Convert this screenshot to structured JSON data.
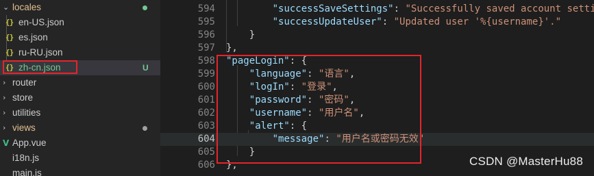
{
  "explorer": {
    "items": [
      {
        "label": "locales",
        "type": "folder-open",
        "color": "#e2c08d",
        "decoration": "dot",
        "decoration_color": "#73c991"
      },
      {
        "label": "en-US.json",
        "type": "json"
      },
      {
        "label": "es.json",
        "type": "json"
      },
      {
        "label": "ru-RU.json",
        "type": "json"
      },
      {
        "label": "zh-cn.json",
        "type": "json",
        "selected": true,
        "color": "#73c991",
        "decoration": "badge",
        "badge": "U",
        "decoration_color": "#73c991"
      },
      {
        "label": "router",
        "type": "folder"
      },
      {
        "label": "store",
        "type": "folder"
      },
      {
        "label": "utilities",
        "type": "folder"
      },
      {
        "label": "views",
        "type": "folder",
        "color": "#e2c08d",
        "decoration": "dot",
        "decoration_color": "#a0a0a0"
      },
      {
        "label": "App.vue",
        "type": "vue"
      },
      {
        "label": "i18n.js",
        "type": "js"
      },
      {
        "label": "main.js",
        "type": "js"
      }
    ]
  },
  "editor": {
    "lines": [
      {
        "num": "594",
        "indent": 8,
        "tokens": [
          {
            "t": "k",
            "v": "\"successSaveSettings\""
          },
          {
            "t": "p",
            "v": ": "
          },
          {
            "t": "s",
            "v": "\"Successfully saved account settings.\""
          },
          {
            "t": "p",
            "v": ","
          }
        ]
      },
      {
        "num": "595",
        "indent": 8,
        "tokens": [
          {
            "t": "k",
            "v": "\"successUpdateUser\""
          },
          {
            "t": "p",
            "v": ": "
          },
          {
            "t": "s",
            "v": "\"Updated user '%{username}'.\""
          }
        ]
      },
      {
        "num": "596",
        "indent": 4,
        "tokens": [
          {
            "t": "b",
            "v": "}"
          }
        ]
      },
      {
        "num": "597",
        "indent": 0,
        "tokens": [
          {
            "t": "b",
            "v": "},"
          }
        ]
      },
      {
        "num": "598",
        "indent": 0,
        "tokens": [
          {
            "t": "k",
            "v": "\"pageLogin\""
          },
          {
            "t": "p",
            "v": ": {"
          }
        ]
      },
      {
        "num": "599",
        "indent": 4,
        "tokens": [
          {
            "t": "k",
            "v": "\"language\""
          },
          {
            "t": "p",
            "v": ": "
          },
          {
            "t": "s",
            "v": "\"语言\""
          },
          {
            "t": "p",
            "v": ","
          }
        ]
      },
      {
        "num": "600",
        "indent": 4,
        "tokens": [
          {
            "t": "k",
            "v": "\"logIn\""
          },
          {
            "t": "p",
            "v": ": "
          },
          {
            "t": "s",
            "v": "\"登录\""
          },
          {
            "t": "p",
            "v": ","
          }
        ]
      },
      {
        "num": "601",
        "indent": 4,
        "tokens": [
          {
            "t": "k",
            "v": "\"password\""
          },
          {
            "t": "p",
            "v": ": "
          },
          {
            "t": "s",
            "v": "\"密码\""
          },
          {
            "t": "p",
            "v": ","
          }
        ]
      },
      {
        "num": "602",
        "indent": 4,
        "tokens": [
          {
            "t": "k",
            "v": "\"username\""
          },
          {
            "t": "p",
            "v": ": "
          },
          {
            "t": "s",
            "v": "\"用户名\""
          },
          {
            "t": "p",
            "v": ","
          }
        ]
      },
      {
        "num": "603",
        "indent": 4,
        "tokens": [
          {
            "t": "k",
            "v": "\"alert\""
          },
          {
            "t": "p",
            "v": ": {"
          }
        ]
      },
      {
        "num": "604",
        "indent": 8,
        "active": true,
        "tokens": [
          {
            "t": "k",
            "v": "\"message\""
          },
          {
            "t": "p",
            "v": ": "
          },
          {
            "t": "s",
            "v": "\"用户名或密码无效\""
          }
        ]
      },
      {
        "num": "605",
        "indent": 4,
        "tokens": [
          {
            "t": "b",
            "v": "}"
          }
        ]
      },
      {
        "num": "606",
        "indent": 0,
        "tokens": [
          {
            "t": "b",
            "v": "},"
          }
        ]
      }
    ]
  },
  "watermark": "CSDN @MasterHu88",
  "colors": {
    "annotation": "#e5252a",
    "json_icon": "#cbcb41",
    "untracked": "#73c991"
  }
}
